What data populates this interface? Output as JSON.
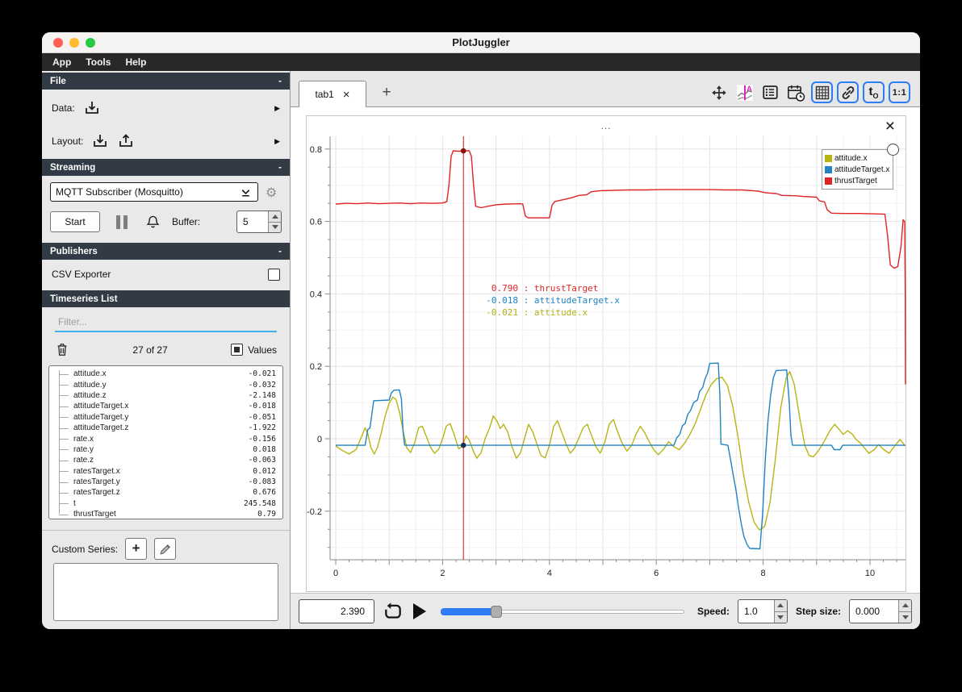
{
  "window": {
    "title": "PlotJuggler",
    "menu": [
      "App",
      "Tools",
      "Help"
    ]
  },
  "sidebar": {
    "file": {
      "header": "File",
      "collapse": "-",
      "data_label": "Data:",
      "layout_label": "Layout:"
    },
    "streaming": {
      "header": "Streaming",
      "collapse": "-",
      "source_selected": "MQTT Subscriber (Mosquitto)",
      "start_label": "Start",
      "buffer_label": "Buffer:",
      "buffer_value": "5"
    },
    "publishers": {
      "header": "Publishers",
      "collapse": "-",
      "csv_exporter_label": "CSV Exporter"
    },
    "timeseries": {
      "header": "Timeseries List",
      "filter_placeholder": "Filter...",
      "count": "27 of 27",
      "values_label": "Values",
      "items": [
        {
          "name": "attitude.x",
          "value": "-0.021"
        },
        {
          "name": "attitude.y",
          "value": "-0.032"
        },
        {
          "name": "attitude.z",
          "value": "-2.148"
        },
        {
          "name": "attitudeTarget.x",
          "value": "-0.018"
        },
        {
          "name": "attitudeTarget.y",
          "value": "-0.051"
        },
        {
          "name": "attitudeTarget.z",
          "value": "-1.922"
        },
        {
          "name": "rate.x",
          "value": "-0.156"
        },
        {
          "name": "rate.y",
          "value": "0.018"
        },
        {
          "name": "rate.z",
          "value": "-0.063"
        },
        {
          "name": "ratesTarget.x",
          "value": "0.012"
        },
        {
          "name": "ratesTarget.y",
          "value": "-0.083"
        },
        {
          "name": "ratesTarget.z",
          "value": "0.676"
        },
        {
          "name": "t",
          "value": "245.548"
        },
        {
          "name": "thrustTarget",
          "value": "0.79"
        }
      ]
    },
    "custom_series": {
      "label": "Custom Series:"
    }
  },
  "main": {
    "tabs": [
      {
        "label": "tab1"
      }
    ],
    "plot_title": "...",
    "toolbar": {
      "t0_label": "t",
      "t0_sub": "O",
      "ratio_label": "1:1"
    }
  },
  "transport": {
    "time": "2.390",
    "speed_label": "Speed:",
    "speed_value": "1.0",
    "step_label": "Step size:",
    "step_value": "0.000",
    "slider_fraction": 0.23
  },
  "chart_data": {
    "type": "line",
    "title": "",
    "xlabel": "",
    "ylabel": "",
    "xlim": [
      -0.11,
      10.66
    ],
    "ylim": [
      -0.335,
      0.84
    ],
    "grid": true,
    "legend_position": "top-right",
    "x_ticks": [
      0,
      2,
      4,
      6,
      8,
      10
    ],
    "y_ticks": [
      "0.8",
      "0.6",
      "0.4",
      "0.2",
      "0",
      "-0.2"
    ],
    "cursor": {
      "t": 2.39,
      "readout": [
        {
          "value": "0.790",
          "name": "thrustTarget",
          "color": "#e02423"
        },
        {
          "value": "-0.018",
          "name": "attitudeTarget.x",
          "color": "#1f83c4"
        },
        {
          "value": "-0.021",
          "name": "attitude.x",
          "color": "#b2b015"
        }
      ],
      "dots": [
        {
          "v": 0.795,
          "color": "#8a0f0f"
        },
        {
          "v": -0.018,
          "color": "#16324f"
        }
      ]
    },
    "series": [
      {
        "name": "attitude.x",
        "color": "#b8b414",
        "points": [
          [
            0,
            -0.02
          ],
          [
            0.12,
            -0.032
          ],
          [
            0.25,
            -0.042
          ],
          [
            0.38,
            -0.03
          ],
          [
            0.48,
            0.005
          ],
          [
            0.55,
            0.03
          ],
          [
            0.6,
            0.015
          ],
          [
            0.66,
            -0.025
          ],
          [
            0.72,
            -0.042
          ],
          [
            0.78,
            -0.025
          ],
          [
            0.85,
            0.015
          ],
          [
            0.92,
            0.06
          ],
          [
            1.0,
            0.098
          ],
          [
            1.07,
            0.115
          ],
          [
            1.13,
            0.108
          ],
          [
            1.2,
            0.07
          ],
          [
            1.27,
            0.015
          ],
          [
            1.33,
            -0.025
          ],
          [
            1.4,
            -0.038
          ],
          [
            1.48,
            -0.01
          ],
          [
            1.55,
            0.03
          ],
          [
            1.62,
            0.035
          ],
          [
            1.7,
            0.005
          ],
          [
            1.78,
            -0.025
          ],
          [
            1.85,
            -0.04
          ],
          [
            1.93,
            -0.028
          ],
          [
            2.0,
            0.0
          ],
          [
            2.07,
            0.035
          ],
          [
            2.14,
            0.042
          ],
          [
            2.22,
            0.01
          ],
          [
            2.3,
            -0.028
          ],
          [
            2.37,
            -0.02
          ],
          [
            2.44,
            0.008
          ],
          [
            2.5,
            -0.004
          ],
          [
            2.57,
            -0.032
          ],
          [
            2.64,
            -0.054
          ],
          [
            2.72,
            -0.038
          ],
          [
            2.8,
            0.002
          ],
          [
            2.88,
            0.03
          ],
          [
            2.95,
            0.063
          ],
          [
            3.02,
            0.048
          ],
          [
            3.08,
            0.028
          ],
          [
            3.14,
            0.04
          ],
          [
            3.22,
            0.018
          ],
          [
            3.3,
            -0.022
          ],
          [
            3.38,
            -0.054
          ],
          [
            3.46,
            -0.038
          ],
          [
            3.54,
            0.004
          ],
          [
            3.61,
            0.04
          ],
          [
            3.69,
            0.018
          ],
          [
            3.76,
            -0.012
          ],
          [
            3.84,
            -0.046
          ],
          [
            3.92,
            -0.053
          ],
          [
            4.0,
            -0.018
          ],
          [
            4.08,
            0.034
          ],
          [
            4.15,
            0.05
          ],
          [
            4.23,
            0.018
          ],
          [
            4.31,
            -0.014
          ],
          [
            4.39,
            -0.04
          ],
          [
            4.47,
            -0.026
          ],
          [
            4.55,
            0.002
          ],
          [
            4.63,
            0.03
          ],
          [
            4.71,
            0.04
          ],
          [
            4.79,
            0.008
          ],
          [
            4.87,
            -0.022
          ],
          [
            4.95,
            -0.04
          ],
          [
            5.04,
            -0.008
          ],
          [
            5.12,
            0.04
          ],
          [
            5.2,
            0.053
          ],
          [
            5.28,
            0.018
          ],
          [
            5.36,
            -0.012
          ],
          [
            5.45,
            -0.034
          ],
          [
            5.54,
            -0.018
          ],
          [
            5.62,
            0.012
          ],
          [
            5.7,
            0.034
          ],
          [
            5.78,
            0.018
          ],
          [
            5.86,
            -0.006
          ],
          [
            5.95,
            -0.03
          ],
          [
            6.04,
            -0.044
          ],
          [
            6.14,
            -0.028
          ],
          [
            6.23,
            -0.008
          ],
          [
            6.33,
            -0.022
          ],
          [
            6.43,
            -0.03
          ],
          [
            6.53,
            -0.012
          ],
          [
            6.63,
            0.012
          ],
          [
            6.73,
            0.042
          ],
          [
            6.83,
            0.082
          ],
          [
            6.93,
            0.122
          ],
          [
            7.03,
            0.15
          ],
          [
            7.13,
            0.166
          ],
          [
            7.23,
            0.17
          ],
          [
            7.33,
            0.148
          ],
          [
            7.43,
            0.09
          ],
          [
            7.53,
            0.005
          ],
          [
            7.63,
            -0.095
          ],
          [
            7.73,
            -0.175
          ],
          [
            7.83,
            -0.23
          ],
          [
            7.93,
            -0.252
          ],
          [
            8.03,
            -0.242
          ],
          [
            8.13,
            -0.175
          ],
          [
            8.23,
            -0.055
          ],
          [
            8.33,
            0.085
          ],
          [
            8.43,
            0.168
          ],
          [
            8.5,
            0.185
          ],
          [
            8.58,
            0.152
          ],
          [
            8.68,
            0.062
          ],
          [
            8.78,
            -0.018
          ],
          [
            8.86,
            -0.046
          ],
          [
            8.94,
            -0.05
          ],
          [
            9.04,
            -0.032
          ],
          [
            9.14,
            -0.008
          ],
          [
            9.24,
            0.02
          ],
          [
            9.34,
            0.04
          ],
          [
            9.42,
            0.026
          ],
          [
            9.5,
            0.012
          ],
          [
            9.58,
            0.022
          ],
          [
            9.66,
            0.014
          ],
          [
            9.74,
            -0.002
          ],
          [
            9.82,
            -0.012
          ],
          [
            9.9,
            -0.026
          ],
          [
            9.98,
            -0.04
          ],
          [
            10.08,
            -0.03
          ],
          [
            10.16,
            -0.016
          ],
          [
            10.26,
            -0.03
          ],
          [
            10.36,
            -0.04
          ],
          [
            10.46,
            -0.02
          ],
          [
            10.56,
            -0.002
          ],
          [
            10.62,
            -0.012
          ],
          [
            10.66,
            -0.02
          ]
        ]
      },
      {
        "name": "attitudeTarget.x",
        "color": "#1f83c4",
        "points": [
          [
            0,
            -0.018
          ],
          [
            0.55,
            -0.018
          ],
          [
            0.6,
            0.025
          ],
          [
            0.64,
            0.03
          ],
          [
            0.67,
            0.062
          ],
          [
            0.71,
            0.105
          ],
          [
            1.0,
            0.107
          ],
          [
            1.04,
            0.126
          ],
          [
            1.09,
            0.134
          ],
          [
            1.19,
            0.135
          ],
          [
            1.23,
            0.11
          ],
          [
            1.26,
            0.02
          ],
          [
            1.29,
            -0.018
          ],
          [
            3.0,
            -0.018
          ],
          [
            5.0,
            -0.018
          ],
          [
            6.33,
            -0.018
          ],
          [
            6.38,
            0.002
          ],
          [
            6.44,
            0.012
          ],
          [
            6.49,
            0.036
          ],
          [
            6.54,
            0.042
          ],
          [
            6.59,
            0.068
          ],
          [
            6.64,
            0.078
          ],
          [
            6.7,
            0.1
          ],
          [
            6.77,
            0.107
          ],
          [
            6.81,
            0.13
          ],
          [
            6.87,
            0.142
          ],
          [
            6.91,
            0.164
          ],
          [
            6.96,
            0.182
          ],
          [
            7.0,
            0.208
          ],
          [
            7.16,
            0.209
          ],
          [
            7.19,
            0.12
          ],
          [
            7.21,
            -0.015
          ],
          [
            7.34,
            -0.018
          ],
          [
            7.38,
            -0.05
          ],
          [
            7.44,
            -0.1
          ],
          [
            7.49,
            -0.14
          ],
          [
            7.54,
            -0.19
          ],
          [
            7.59,
            -0.235
          ],
          [
            7.64,
            -0.27
          ],
          [
            7.7,
            -0.292
          ],
          [
            7.75,
            -0.303
          ],
          [
            7.94,
            -0.304
          ],
          [
            7.99,
            -0.21
          ],
          [
            8.04,
            -0.06
          ],
          [
            8.09,
            0.05
          ],
          [
            8.14,
            0.12
          ],
          [
            8.19,
            0.168
          ],
          [
            8.24,
            0.188
          ],
          [
            8.44,
            0.19
          ],
          [
            8.49,
            0.1
          ],
          [
            8.52,
            0.01
          ],
          [
            8.55,
            -0.018
          ],
          [
            9.28,
            -0.018
          ],
          [
            9.33,
            -0.03
          ],
          [
            9.44,
            -0.03
          ],
          [
            9.49,
            -0.018
          ],
          [
            10.66,
            -0.018
          ]
        ]
      },
      {
        "name": "thrustTarget",
        "color": "#e02423",
        "points": [
          [
            0,
            0.648
          ],
          [
            0.2,
            0.65
          ],
          [
            0.4,
            0.649
          ],
          [
            0.6,
            0.651
          ],
          [
            0.8,
            0.649
          ],
          [
            1.0,
            0.65
          ],
          [
            1.2,
            0.651
          ],
          [
            1.4,
            0.649
          ],
          [
            1.6,
            0.651
          ],
          [
            1.8,
            0.65
          ],
          [
            2.0,
            0.651
          ],
          [
            2.08,
            0.655
          ],
          [
            2.12,
            0.7
          ],
          [
            2.16,
            0.78
          ],
          [
            2.2,
            0.795
          ],
          [
            2.3,
            0.794
          ],
          [
            2.4,
            0.795
          ],
          [
            2.5,
            0.795
          ],
          [
            2.54,
            0.78
          ],
          [
            2.58,
            0.7
          ],
          [
            2.62,
            0.642
          ],
          [
            2.72,
            0.638
          ],
          [
            2.85,
            0.642
          ],
          [
            3.0,
            0.646
          ],
          [
            3.2,
            0.648
          ],
          [
            3.45,
            0.649
          ],
          [
            3.5,
            0.648
          ],
          [
            3.55,
            0.615
          ],
          [
            3.6,
            0.61
          ],
          [
            3.8,
            0.61
          ],
          [
            4.0,
            0.61
          ],
          [
            4.05,
            0.645
          ],
          [
            4.1,
            0.655
          ],
          [
            4.25,
            0.66
          ],
          [
            4.4,
            0.665
          ],
          [
            4.55,
            0.672
          ],
          [
            4.7,
            0.674
          ],
          [
            4.78,
            0.682
          ],
          [
            4.95,
            0.685
          ],
          [
            5.2,
            0.686
          ],
          [
            5.5,
            0.687
          ],
          [
            5.8,
            0.687
          ],
          [
            6.1,
            0.688
          ],
          [
            6.4,
            0.688
          ],
          [
            6.7,
            0.688
          ],
          [
            7.0,
            0.688
          ],
          [
            7.3,
            0.687
          ],
          [
            7.6,
            0.687
          ],
          [
            7.9,
            0.684
          ],
          [
            8.05,
            0.679
          ],
          [
            8.25,
            0.677
          ],
          [
            8.35,
            0.672
          ],
          [
            8.6,
            0.671
          ],
          [
            8.75,
            0.669
          ],
          [
            9.0,
            0.667
          ],
          [
            9.05,
            0.657
          ],
          [
            9.15,
            0.654
          ],
          [
            9.2,
            0.632
          ],
          [
            9.28,
            0.623
          ],
          [
            9.5,
            0.622
          ],
          [
            9.8,
            0.622
          ],
          [
            10.1,
            0.621
          ],
          [
            10.28,
            0.62
          ],
          [
            10.33,
            0.56
          ],
          [
            10.38,
            0.48
          ],
          [
            10.45,
            0.471
          ],
          [
            10.52,
            0.475
          ],
          [
            10.58,
            0.53
          ],
          [
            10.62,
            0.605
          ],
          [
            10.65,
            0.6
          ],
          [
            10.66,
            0.4
          ],
          [
            10.665,
            0.15
          ]
        ]
      }
    ]
  }
}
